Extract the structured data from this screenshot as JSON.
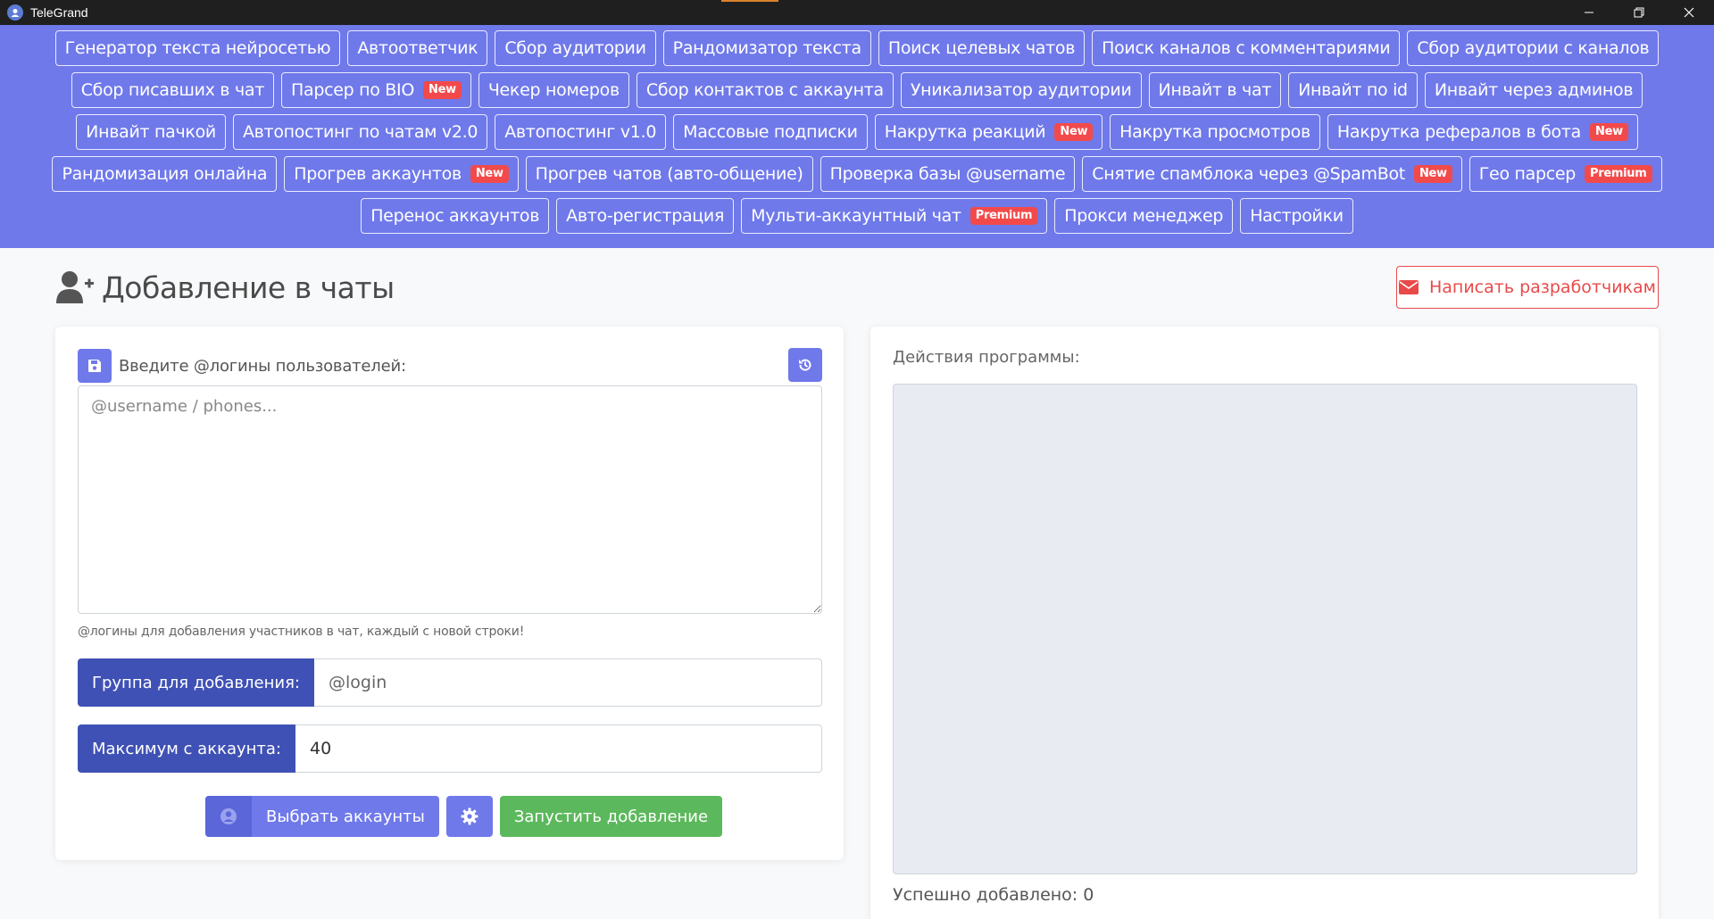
{
  "window": {
    "title": "TeleGrand"
  },
  "nav": {
    "rows": [
      [
        {
          "label": "Генератор текста нейросетью",
          "badge": ""
        },
        {
          "label": "Автоответчик",
          "badge": ""
        },
        {
          "label": "Сбор аудитории",
          "badge": ""
        },
        {
          "label": "Рандомизатор текста",
          "badge": ""
        },
        {
          "label": "Поиск целевых чатов",
          "badge": ""
        },
        {
          "label": "Поиск каналов с комментариями",
          "badge": ""
        },
        {
          "label": "Сбор аудитории с каналов",
          "badge": ""
        }
      ],
      [
        {
          "label": "Сбор писавших в чат",
          "badge": ""
        },
        {
          "label": "Парсер по BIO",
          "badge": "New"
        },
        {
          "label": "Чекер номеров",
          "badge": ""
        },
        {
          "label": "Сбор контактов с аккаунта",
          "badge": ""
        },
        {
          "label": "Уникализатор аудитории",
          "badge": ""
        },
        {
          "label": "Инвайт в чат",
          "badge": ""
        },
        {
          "label": "Инвайт по id",
          "badge": ""
        },
        {
          "label": "Инвайт через админов",
          "badge": ""
        }
      ],
      [
        {
          "label": "Инвайт пачкой",
          "badge": ""
        },
        {
          "label": "Автопостинг по чатам v2.0",
          "badge": ""
        },
        {
          "label": "Автопостинг v1.0",
          "badge": ""
        },
        {
          "label": "Массовые подписки",
          "badge": ""
        },
        {
          "label": "Накрутка реакций",
          "badge": "New"
        },
        {
          "label": "Накрутка просмотров",
          "badge": ""
        },
        {
          "label": "Накрутка рефералов в бота",
          "badge": "New"
        }
      ],
      [
        {
          "label": "Рандомизация онлайна",
          "badge": ""
        },
        {
          "label": "Прогрев аккаунтов",
          "badge": "New"
        },
        {
          "label": "Прогрев чатов (авто-общение)",
          "badge": ""
        },
        {
          "label": "Проверка базы @username",
          "badge": ""
        },
        {
          "label": "Снятие спамблока через @SpamBot",
          "badge": "New"
        },
        {
          "label": "Гео парсер",
          "badge": "Premium"
        }
      ],
      [
        {
          "label": "Перенос аккаунтов",
          "badge": ""
        },
        {
          "label": "Авто-регистрация",
          "badge": ""
        },
        {
          "label": "Мульти-аккаунтный чат",
          "badge": "Premium"
        },
        {
          "label": "Прокси менеджер",
          "badge": ""
        },
        {
          "label": "Настройки",
          "badge": ""
        }
      ]
    ]
  },
  "page": {
    "title": "Добавление в чаты",
    "contact_dev_label": "Написать разработчикам"
  },
  "form": {
    "logins_label": "Введите @логины пользователей:",
    "logins_placeholder": "@username / phones...",
    "logins_value": "",
    "hint": "@логины для добавления участников в чат, каждый с новой строки!",
    "group_label": "Группа для добавления:",
    "group_placeholder": "@login",
    "group_value": "",
    "max_label": "Максимум с аккаунта:",
    "max_value": "40",
    "select_accounts_label": "Выбрать аккаунты",
    "start_label": "Запустить добавление"
  },
  "log": {
    "label": "Действия программы:",
    "success_text": "Успешно добавлено: 0"
  },
  "colors": {
    "nav_bg": "#6f79ea",
    "prefix_bg": "#3f51b5",
    "start_btn": "#5cb85c",
    "danger": "#e84a4a"
  }
}
